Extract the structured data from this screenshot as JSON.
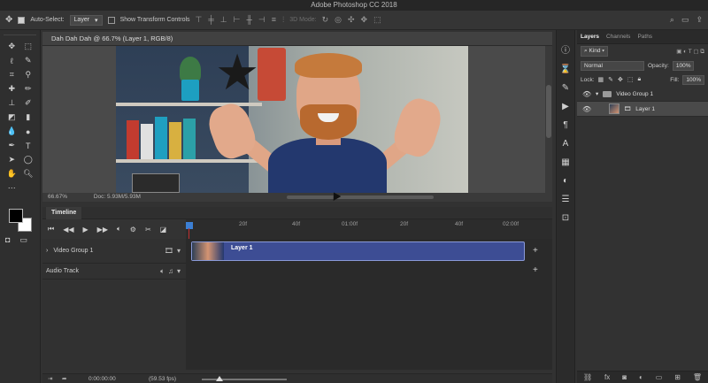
{
  "app": {
    "title": "Adobe Photoshop CC 2018"
  },
  "options_bar": {
    "auto_select_label": "Auto-Select:",
    "auto_select_value": "Layer",
    "transform_controls_label": "Show Transform Controls",
    "mode_3d_label": "3D Mode:"
  },
  "document": {
    "tab_title": "Dah Dah Dah @ 66.7% (Layer 1, RGB/8)",
    "zoom": "66.67%",
    "doc_size": "Doc: 5.93M/5.93M"
  },
  "timeline": {
    "panel_label": "Timeline",
    "ruler_ticks": [
      "20f",
      "40f",
      "01:00f",
      "20f",
      "40f",
      "02:00f"
    ],
    "tracks": [
      {
        "name": "Video Group 1",
        "clip_label": "Layer 1"
      },
      {
        "name": "Audio Track"
      }
    ],
    "timecode": "0:00:00:00",
    "fps": "(59.53 fps)",
    "playhead_fraction": 0.0
  },
  "layers_panel": {
    "tabs": [
      "Layers",
      "Channels",
      "Paths"
    ],
    "filter_value": "Kind",
    "blend_mode": "Normal",
    "opacity_label": "Opacity:",
    "opacity_value": "100%",
    "lock_label": "Lock:",
    "fill_label": "Fill:",
    "fill_value": "100%",
    "items": [
      {
        "name": "Video Group 1",
        "type": "group"
      },
      {
        "name": "Layer 1",
        "type": "layer"
      }
    ]
  },
  "colors": {
    "foreground": "#000000",
    "background": "#ffffff",
    "clip_fill": "#3d4d94",
    "playhead": "#c03030"
  }
}
